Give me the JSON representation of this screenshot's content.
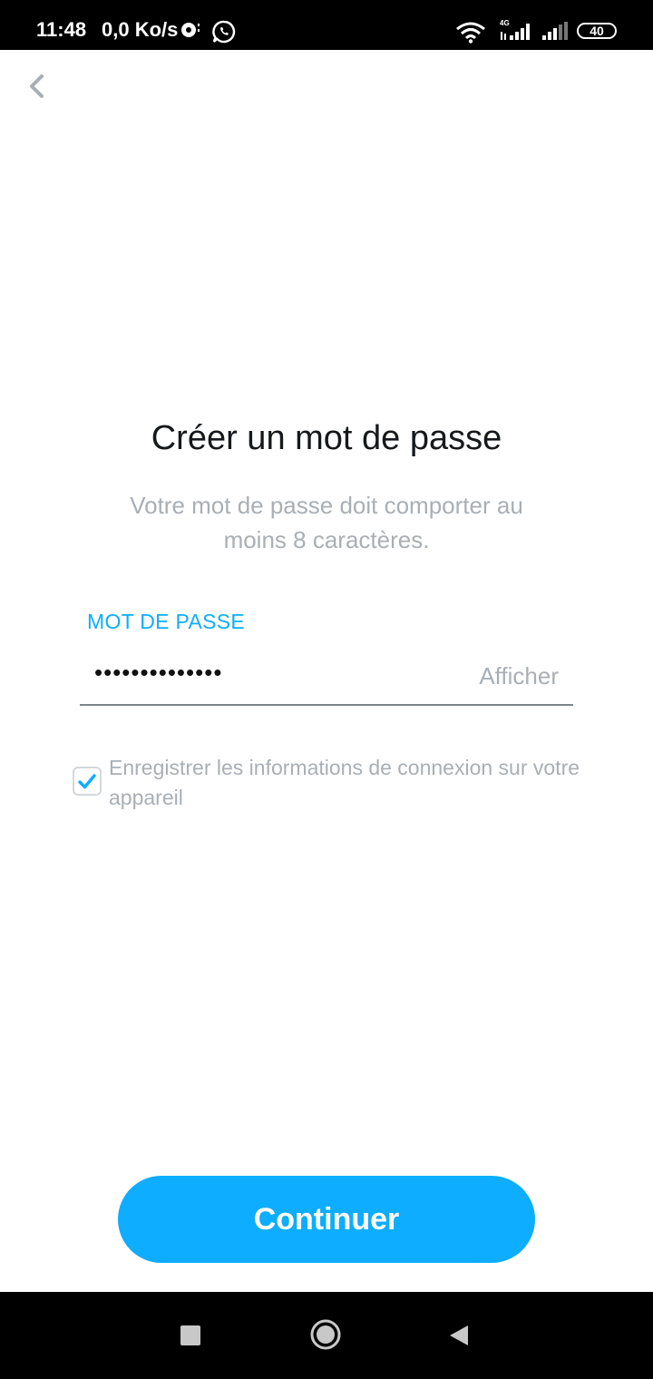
{
  "status_bar": {
    "time": "11:48",
    "speed": "0,0 Ko/s",
    "network_type": "4G",
    "battery": "40",
    "icons": [
      "notification-icon",
      "whatsapp-icon",
      "wifi-icon",
      "signal-icon",
      "battery-icon"
    ]
  },
  "header": {
    "back_icon": "chevron-left-icon"
  },
  "main": {
    "title": "Créer un mot de passe",
    "subtitle": "Votre mot de passe doit comporter au moins 8 caractères.",
    "password_label": "MOT DE PASSE",
    "password_value": "••••••••••••••",
    "show_label": "Afficher",
    "save_login": {
      "label": "Enregistrer les informations de connexion sur votre appareil",
      "checked": true
    },
    "continue_label": "Continuer"
  },
  "nav_bar": {
    "icons": [
      "recent-apps-icon",
      "home-icon",
      "back-icon"
    ]
  },
  "colors": {
    "accent": "#0eadff",
    "title": "#16191c",
    "muted": "#a9afb5"
  }
}
